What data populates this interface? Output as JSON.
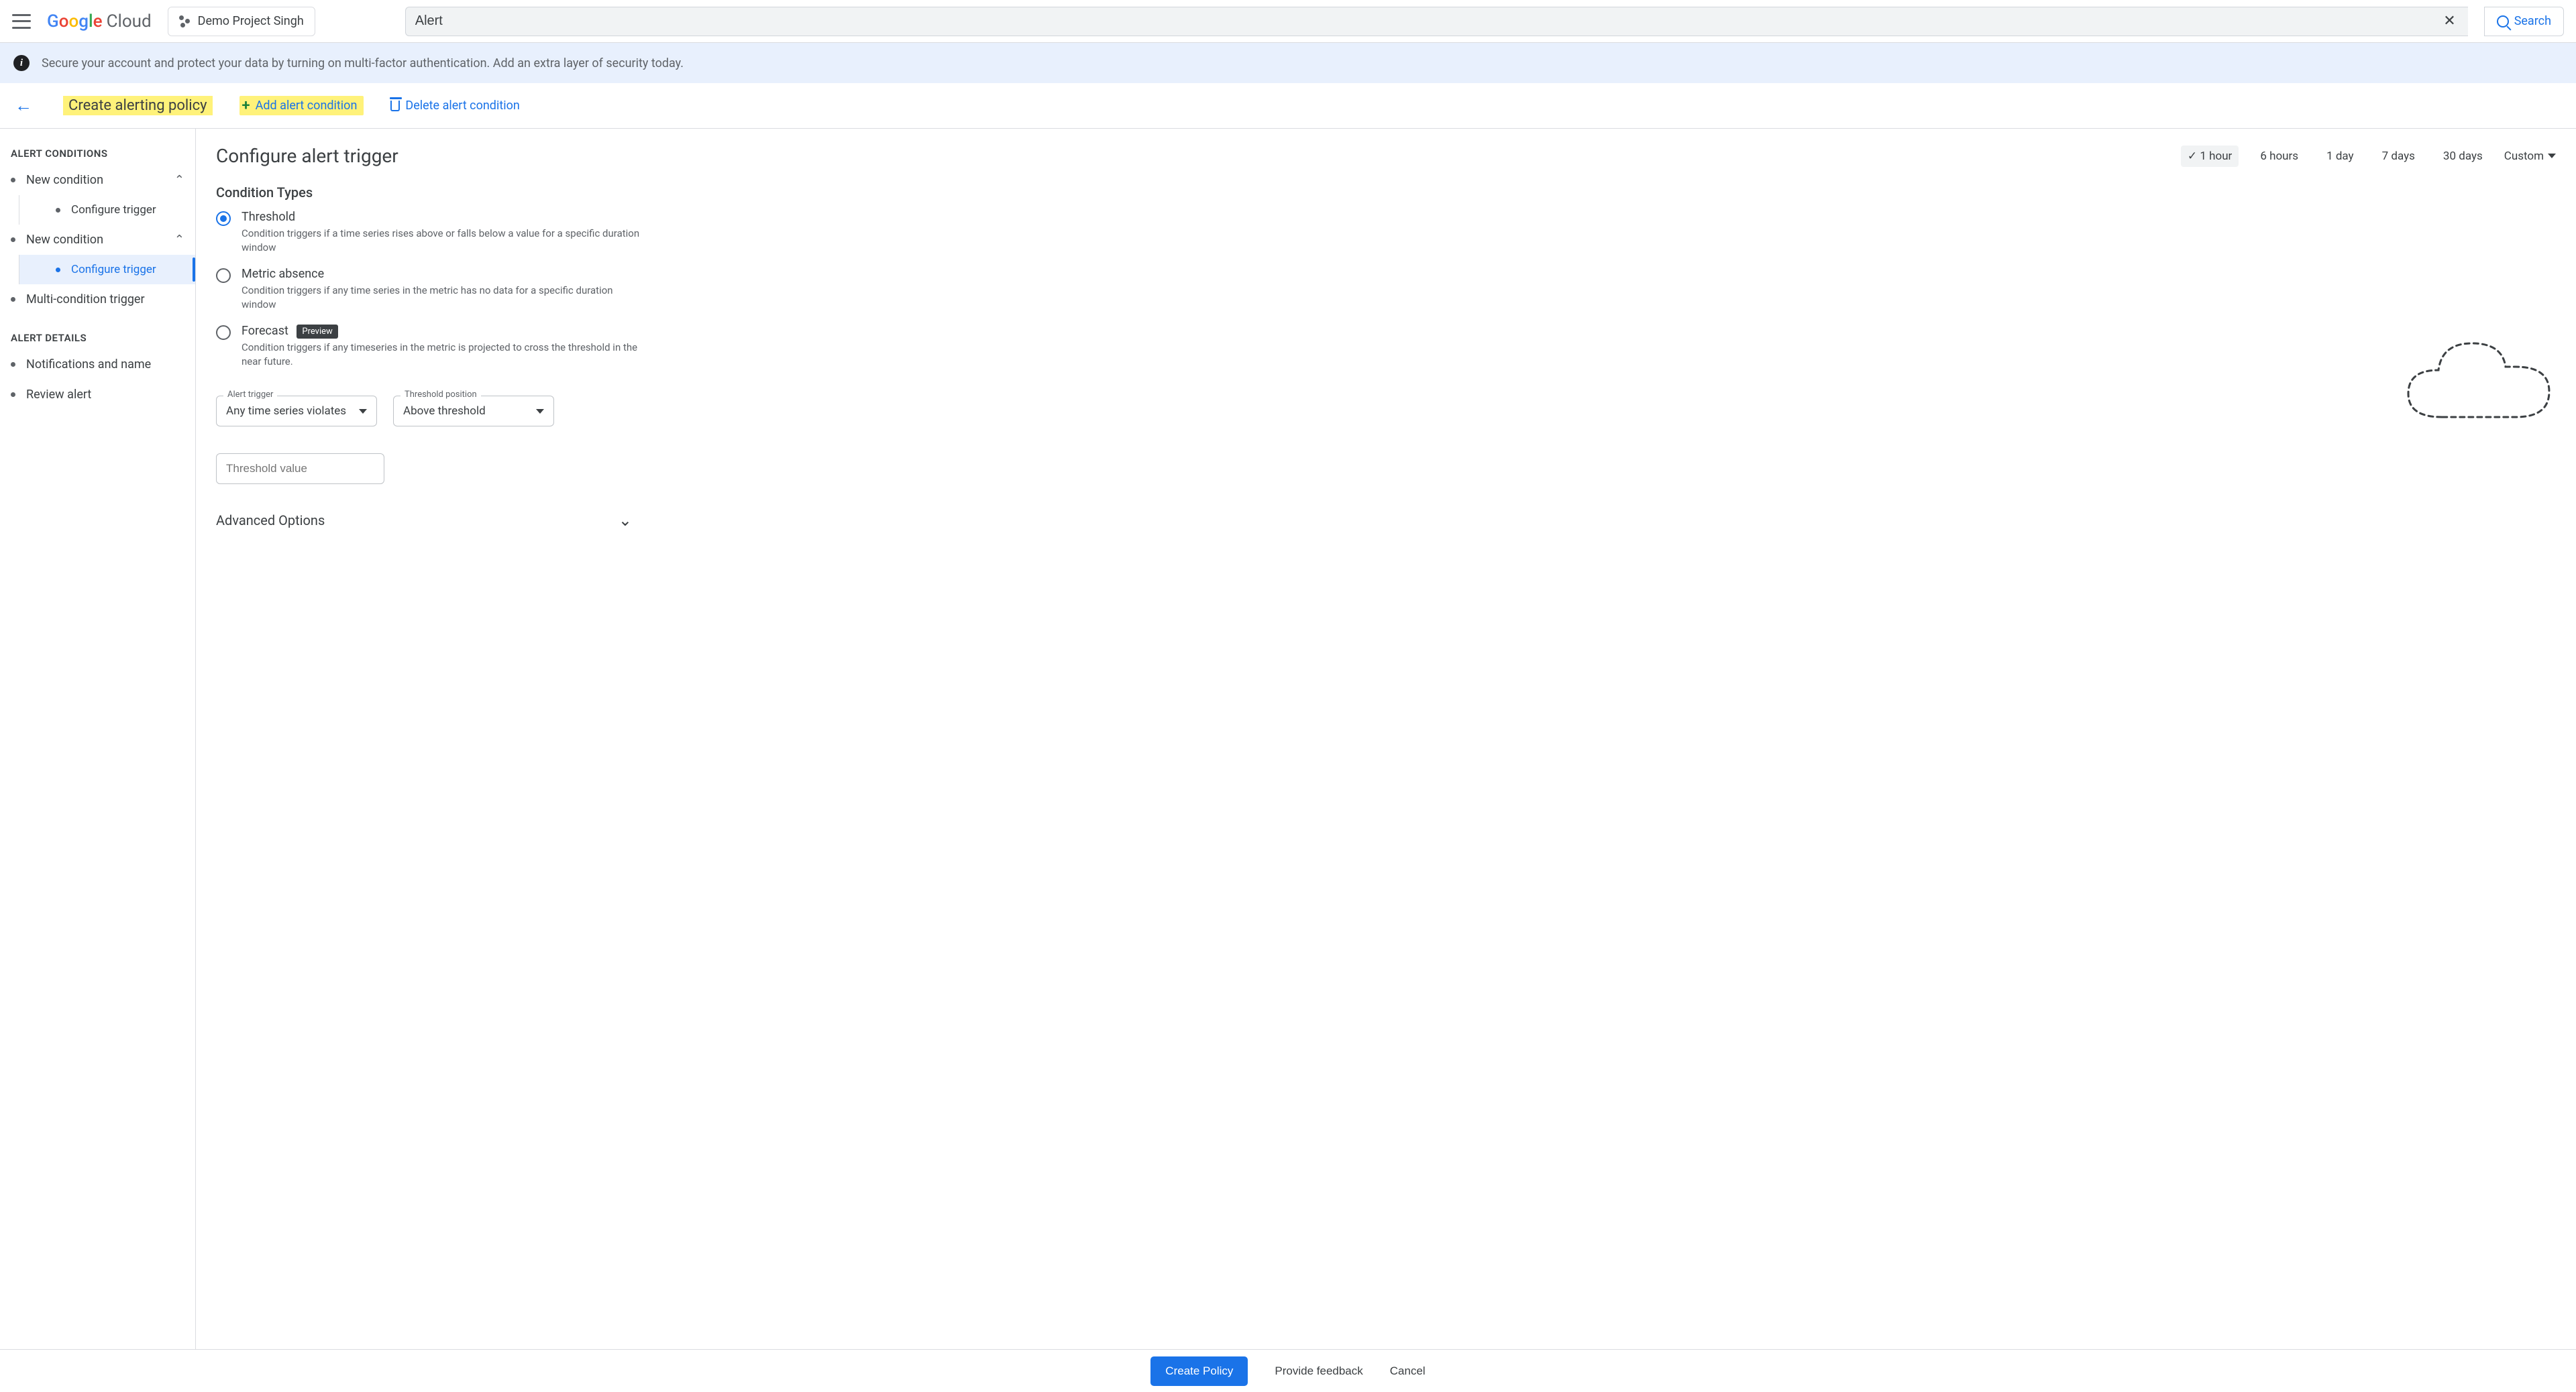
{
  "header": {
    "logo_cloud": "Cloud",
    "project_name": "Demo Project Singh",
    "search_value": "Alert",
    "search_button": "Search"
  },
  "banner": {
    "text": "Secure your account and protect your data by turning on multi-factor authentication. Add an extra layer of security today."
  },
  "page_header": {
    "title": "Create alerting policy",
    "add_condition": "Add alert condition",
    "delete_condition": "Delete alert condition"
  },
  "sidebar": {
    "section_conditions": "ALERT CONDITIONS",
    "cond1": "New condition",
    "cond1_sub": "Configure trigger",
    "cond2": "New condition",
    "cond2_sub": "Configure trigger",
    "multi": "Multi-condition trigger",
    "section_details": "ALERT DETAILS",
    "notifications": "Notifications and name",
    "review": "Review alert"
  },
  "main": {
    "title": "Configure alert trigger",
    "time_range": {
      "h1": "1 hour",
      "h6": "6 hours",
      "d1": "1 day",
      "d7": "7 days",
      "d30": "30 days",
      "custom": "Custom"
    },
    "condition_types_heading": "Condition Types",
    "types": {
      "threshold": {
        "label": "Threshold",
        "desc": "Condition triggers if a time series rises above or falls below a value for a specific duration window"
      },
      "absence": {
        "label": "Metric absence",
        "desc": "Condition triggers if any time series in the metric has no data for a specific duration window"
      },
      "forecast": {
        "label": "Forecast",
        "preview": "Preview",
        "desc": "Condition triggers if any timeseries in the metric is projected to cross the threshold in the near future."
      }
    },
    "fields": {
      "trigger_label": "Alert trigger",
      "trigger_value": "Any time series violates",
      "position_label": "Threshold position",
      "position_value": "Above threshold",
      "threshold_value_placeholder": "Threshold value"
    },
    "advanced": "Advanced Options"
  },
  "footer": {
    "create": "Create Policy",
    "feedback": "Provide feedback",
    "cancel": "Cancel"
  }
}
